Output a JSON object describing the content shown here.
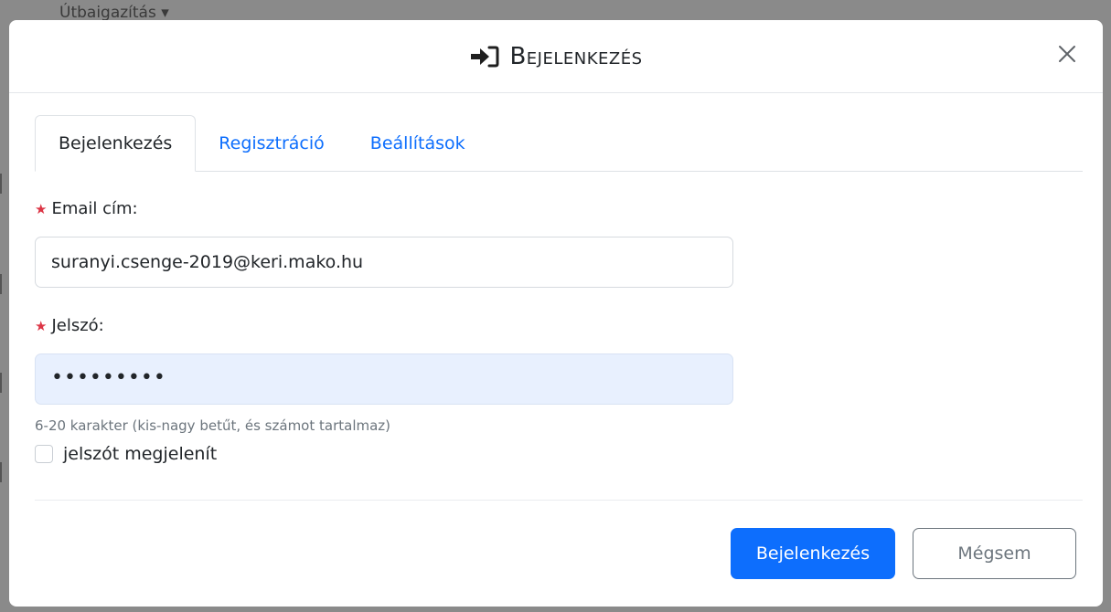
{
  "background": {
    "partial_text": "Útbaigazítás ▾"
  },
  "modal": {
    "title": "Bejelenkezés",
    "title_icon": "sign-in-icon",
    "close_icon": "close-icon",
    "close_symbol": "✕"
  },
  "tabs": [
    {
      "label": "Bejelenkezés",
      "active": true
    },
    {
      "label": "Regisztráció",
      "active": false
    },
    {
      "label": "Beállítások",
      "active": false
    }
  ],
  "form": {
    "required_marker": "★",
    "email": {
      "label": "Email cím:",
      "value": "suranyi.csenge-2019@keri.mako.hu"
    },
    "password": {
      "label": "Jelszó:",
      "value": "•••••••••",
      "help": "6-20 karakter (kis-nagy betűt, és számot tartalmaz)"
    },
    "show_password": {
      "label": "jelszót megjelenít",
      "checked": false
    }
  },
  "footer": {
    "submit_label": "Bejelenkezés",
    "cancel_label": "Mégsem"
  },
  "colors": {
    "primary": "#0d6efd",
    "required": "#dc3545",
    "autofill_bg": "#e8f0fe",
    "secondary": "#6c757d"
  }
}
